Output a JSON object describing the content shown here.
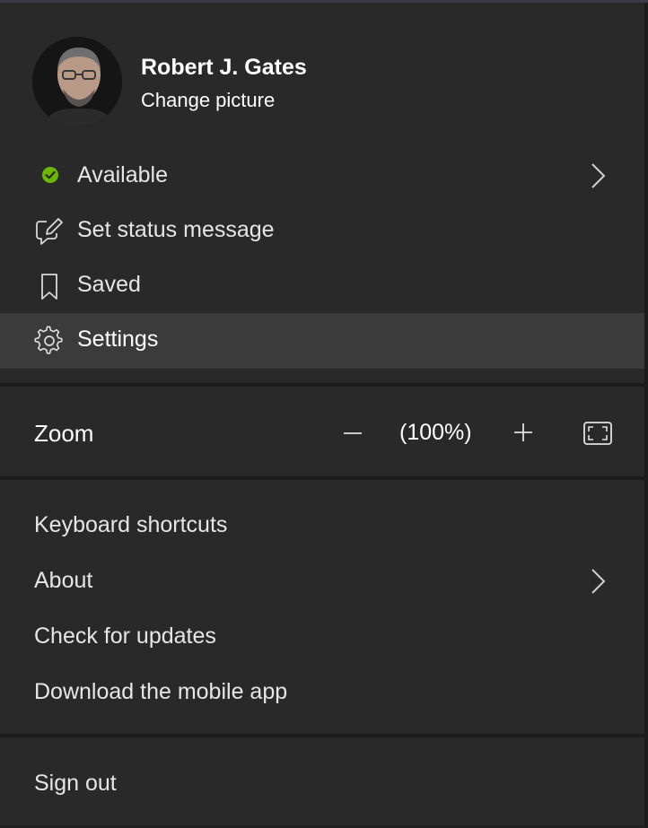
{
  "profile": {
    "name": "Robert J. Gates",
    "change_picture": "Change picture"
  },
  "status_section": {
    "items": [
      {
        "label": "Available",
        "icon": "available-status-dot-icon",
        "status_color": "#6bb700",
        "has_submenu": true
      },
      {
        "label": "Set status message",
        "icon": "edit-message-icon"
      },
      {
        "label": "Saved",
        "icon": "bookmark-icon"
      },
      {
        "label": "Settings",
        "icon": "gear-icon",
        "highlighted": true
      }
    ]
  },
  "zoom": {
    "label": "Zoom",
    "minus": "−",
    "value": "(100%)",
    "plus": "+",
    "fullscreen_icon": "fullscreen-icon"
  },
  "info_section": {
    "items": [
      {
        "label": "Keyboard shortcuts"
      },
      {
        "label": "About",
        "has_submenu": true
      },
      {
        "label": "Check for updates"
      },
      {
        "label": "Download the mobile app"
      }
    ]
  },
  "sign_out": {
    "label": "Sign out"
  },
  "colors": {
    "background": "#292929",
    "hover": "#3b3b3b",
    "divider": "#1c1c1c",
    "text": "#e6e6e6",
    "available": "#6bb700"
  }
}
